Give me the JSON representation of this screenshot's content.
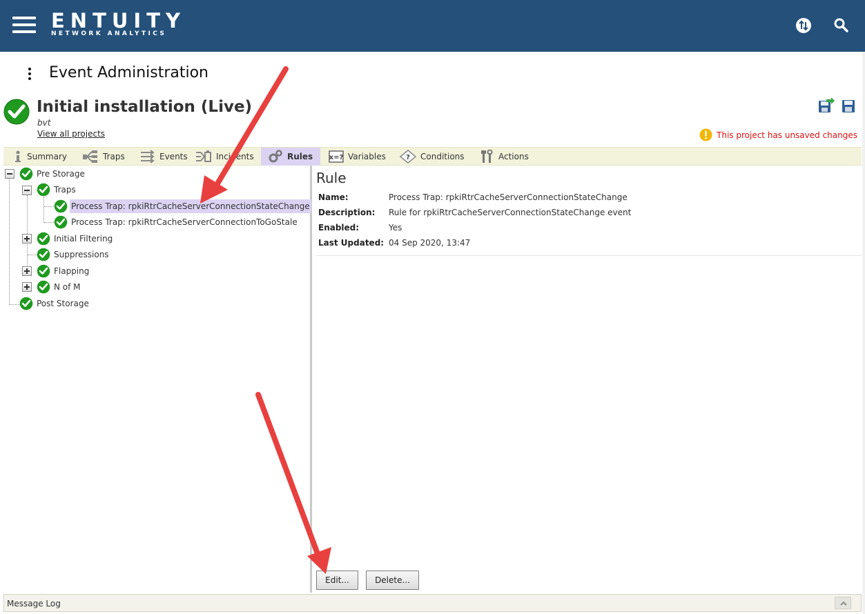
{
  "header": {
    "brand_name": "ENTUITY",
    "brand_sub": "NETWORK ANALYTICS",
    "icons": [
      "menu-icon",
      "switch-icon",
      "search-icon"
    ],
    "bg_color": "#24507a"
  },
  "page": {
    "title": "Event Administration"
  },
  "project": {
    "title": "Initial installation (Live)",
    "subtitle": "bvt",
    "link": "View all projects",
    "unsaved_message": "This project has unsaved changes",
    "status_color": "#1f9a1f",
    "warning_color": "#f2b707"
  },
  "tabs": [
    {
      "label": "Summary",
      "icon": "info-icon"
    },
    {
      "label": "Traps",
      "icon": "traps-icon"
    },
    {
      "label": "Events",
      "icon": "events-icon"
    },
    {
      "label": "Incidents",
      "icon": "incidents-icon"
    },
    {
      "label": "Rules",
      "icon": "gears-icon",
      "active": true
    },
    {
      "label": "Variables",
      "icon": "variable-icon"
    },
    {
      "label": "Conditions",
      "icon": "condition-icon"
    },
    {
      "label": "Actions",
      "icon": "tools-icon"
    }
  ],
  "tree": {
    "pre_storage": "Pre Storage",
    "traps": "Traps",
    "trap_rule_1": "Process Trap: rpkiRtrCacheServerConnectionStateChange",
    "trap_rule_2": "Process Trap: rpkiRtrCacheServerConnectionToGoStale",
    "initial_filtering": "Initial Filtering",
    "suppressions": "Suppressions",
    "flapping": "Flapping",
    "n_of_m": "N of M",
    "post_storage": "Post Storage"
  },
  "detail": {
    "title": "Rule",
    "name_label": "Name:",
    "name_value": "Process Trap: rpkiRtrCacheServerConnectionStateChange",
    "description_label": "Description:",
    "description_value": "Rule for rpkiRtrCacheServerConnectionStateChange event",
    "enabled_label": "Enabled:",
    "enabled_value": "Yes",
    "updated_label": "Last Updated:",
    "updated_value": "04 Sep 2020, 13:47",
    "edit_button": "Edit...",
    "delete_button": "Delete..."
  },
  "footer": {
    "message_log": "Message Log"
  },
  "annotation_color": "#e8403e"
}
